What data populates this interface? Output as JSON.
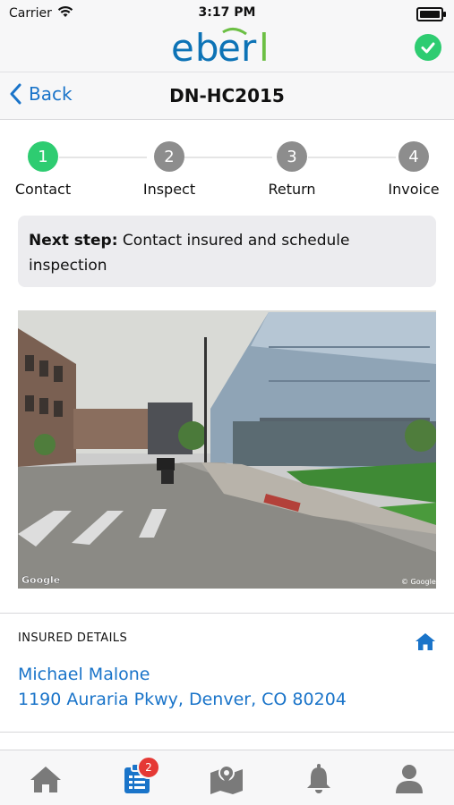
{
  "status_bar": {
    "carrier": "Carrier",
    "time": "3:17 PM"
  },
  "brand": {
    "logo_text": "eberl",
    "status_icon": "check-circle-icon"
  },
  "nav": {
    "back_label": "Back",
    "title": "DN-HC2015"
  },
  "steps": [
    {
      "number": "1",
      "label": "Contact",
      "state": "active"
    },
    {
      "number": "2",
      "label": "Inspect",
      "state": "pending"
    },
    {
      "number": "3",
      "label": "Return",
      "state": "pending"
    },
    {
      "number": "4",
      "label": "Invoice",
      "state": "pending"
    }
  ],
  "next_step": {
    "prefix": "Next step:",
    "text": "Contact insured and schedule inspection"
  },
  "street_view": {
    "watermark_left": "Google",
    "watermark_right": "© Google"
  },
  "insured_details": {
    "heading": "INSURED DETAILS",
    "name": "Michael Malone",
    "address": "1190 Auraria Pkwy, Denver, CO 80204",
    "action_icon": "home-icon"
  },
  "tab_bar": {
    "items": [
      {
        "icon": "home-icon"
      },
      {
        "icon": "clipboard-list-icon",
        "badge": "2",
        "selected": true
      },
      {
        "icon": "map-pin-icon"
      },
      {
        "icon": "bell-icon"
      },
      {
        "icon": "user-icon"
      }
    ]
  },
  "colors": {
    "accent_blue": "#1a74c9",
    "success_green": "#2ecc71",
    "badge_red": "#e53935"
  }
}
